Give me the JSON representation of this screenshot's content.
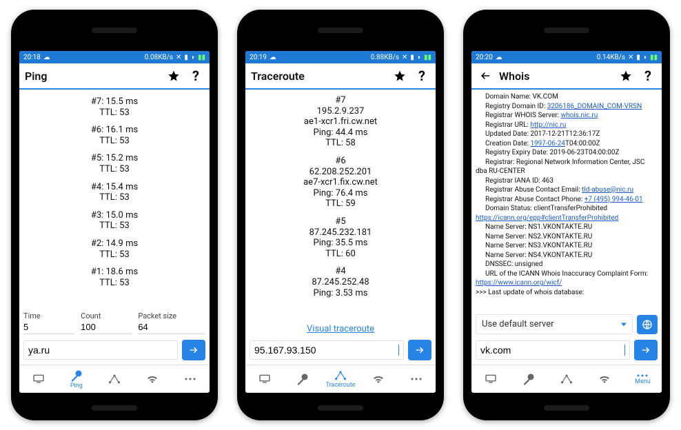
{
  "phones": [
    {
      "status": {
        "time": "20:18",
        "net_speed": "0.08KB/s"
      },
      "titlebar": {
        "title": "Ping",
        "has_back": false
      },
      "ping_results": [
        {
          "header": "#7: 15.5 ms",
          "ttl": "TTL: 53"
        },
        {
          "header": "#6: 16.1 ms",
          "ttl": "TTL: 53"
        },
        {
          "header": "#5: 15.2 ms",
          "ttl": "TTL: 53"
        },
        {
          "header": "#4: 15.4 ms",
          "ttl": "TTL: 53"
        },
        {
          "header": "#3: 15.0 ms",
          "ttl": "TTL: 53"
        },
        {
          "header": "#2: 14.9 ms",
          "ttl": "TTL: 53"
        },
        {
          "header": "#1: 18.6 ms",
          "ttl": "TTL: 53"
        }
      ],
      "ping_params": {
        "labels": {
          "time": "Time",
          "count": "Count",
          "packet": "Packet size"
        },
        "values": {
          "time": "5",
          "count": "100",
          "packet": "64"
        }
      },
      "query": "ya.ru",
      "nav": {
        "active": 1,
        "active_label": "Ping"
      }
    },
    {
      "status": {
        "time": "20:19",
        "net_speed": "0.88KB/s"
      },
      "titlebar": {
        "title": "Traceroute",
        "has_back": false
      },
      "tr_results": [
        {
          "hop": "#7",
          "ip": "195.2.9.237",
          "host": "ae1-xcr1.fri.cw.net",
          "ping": "Ping: 44.4 ms",
          "ttl": "TTL: 58"
        },
        {
          "hop": "#6",
          "ip": "62.208.252.201",
          "host": "ae7-xcr1.fix.cw.net",
          "ping": "Ping: 76.4 ms",
          "ttl": "TTL: 59"
        },
        {
          "hop": "#5",
          "ip": "87.245.232.181",
          "host": "",
          "ping": "Ping: 35.5 ms",
          "ttl": "TTL: 60"
        },
        {
          "hop": "#4",
          "ip": "87.245.252.48",
          "host": "",
          "ping": "Ping: 3.53 ms",
          "ttl": ""
        }
      ],
      "visual_link": "Visual traceroute",
      "query": "95.167.93.150",
      "nav": {
        "active": 2,
        "active_label": "Traceroute"
      }
    },
    {
      "status": {
        "time": "20:20",
        "net_speed": "0.14KB/s"
      },
      "titlebar": {
        "title": "Whois",
        "has_back": true
      },
      "whois_lines": [
        {
          "text": "Domain Name: VK.COM",
          "indent": 1
        },
        {
          "text": "Registry Domain ID: ",
          "link": "3206186_DOMAIN_COM-VRSN",
          "indent": 1
        },
        {
          "text": "Registrar WHOIS Server: ",
          "link": "whois.nic.ru",
          "indent": 1
        },
        {
          "text": "Registrar URL: ",
          "link": "http://nic.ru",
          "indent": 1
        },
        {
          "text": "Updated Date: 2017-12-21T12:36:17Z",
          "indent": 1
        },
        {
          "text": "Creation Date: ",
          "link": "1997-06-24",
          "after": "T04:00:00Z",
          "indent": 1
        },
        {
          "text": "Registry Expiry Date: 2019-06-23T04:00:00Z",
          "indent": 1
        },
        {
          "text": "Registrar: Regional Network Information Center, JSC",
          "indent": 1
        },
        {
          "text": "dba RU-CENTER",
          "indent": 0
        },
        {
          "text": "Registrar IANA ID: 463",
          "indent": 1
        },
        {
          "text": "Registrar Abuse Contact Email: ",
          "link": "tld-abuse@nic.ru",
          "indent": 1
        },
        {
          "text": "Registrar Abuse Contact Phone: ",
          "link": "+7 (495) 994-46-01",
          "indent": 1
        },
        {
          "text": "Domain Status: clientTransferProhibited",
          "indent": 1
        },
        {
          "text": "",
          "link": "https://icann.org/epp#clientTransferProhibited",
          "indent": 0
        },
        {
          "text": "Name Server: NS1.VKONTAKTE.RU",
          "indent": 1
        },
        {
          "text": "Name Server: NS2.VKONTAKTE.RU",
          "indent": 1
        },
        {
          "text": "Name Server: NS3.VKONTAKTE.RU",
          "indent": 1
        },
        {
          "text": "Name Server: NS4.VKONTAKTE.RU",
          "indent": 1
        },
        {
          "text": "DNSSEC: unsigned",
          "indent": 1
        },
        {
          "text": "URL of the ICANN Whois Inaccuracy Complaint Form:",
          "indent": 1
        },
        {
          "text": "",
          "link": "https://www.icann.org/wicf/",
          "indent": 0
        },
        {
          "text": ">>> Last update of whois database:",
          "indent": 0
        }
      ],
      "server_select": "Use default server",
      "query": "vk.com",
      "nav": {
        "active": 4,
        "active_label": "Menu"
      }
    }
  ]
}
